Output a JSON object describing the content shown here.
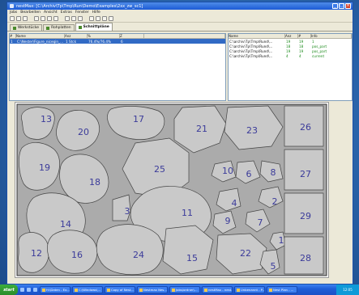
{
  "window": {
    "title": "nestMax: [C:\\Archiv\\Tp\\Tmp\\Run\\Demo\\Examples\\2xx_zw_sc1]"
  },
  "menu": [
    "Jobs",
    "Bearbeiten",
    "Ansicht",
    "Extras",
    "Fenster",
    "Hilfe"
  ],
  "tabs": [
    {
      "label": "Werkstücke"
    },
    {
      "label": "Rohplatten"
    },
    {
      "label": "Schnittpläne"
    }
  ],
  "left_table": {
    "headers": [
      "#",
      "Name",
      "Anz",
      "%",
      "Z",
      ""
    ],
    "rows": [
      [
        "1",
        "C:\\Nester\\Figure_niceqin_...",
        "1 Stck",
        "76.4%/76.4%",
        "6",
        ""
      ]
    ]
  },
  "right_table": {
    "headers": [
      "Name",
      "Anz",
      "#",
      "Info"
    ],
    "rows": [
      [
        "C:\\archiv\\Tp\\Tmp\\Rund\\...",
        "19",
        "19",
        "1"
      ],
      [
        "C:\\archiv\\Tp\\Tmp\\Rund\\...",
        "18",
        "18",
        "pos_part"
      ],
      [
        "C:\\archiv\\Tp\\Tmp\\Rund\\...",
        "19",
        "19",
        "pos_part"
      ],
      [
        "C:\\archiv\\Tp\\Tmp\\Rund\\...",
        "4",
        "4",
        "current"
      ]
    ]
  },
  "nest": {
    "parts": [
      {
        "label": "13",
        "color": "#c9c9c9"
      },
      {
        "label": "20",
        "color": "#c9c9c9"
      },
      {
        "label": "17",
        "color": "#c9c9c9"
      },
      {
        "label": "21",
        "color": "#c9c9c9"
      },
      {
        "label": "23",
        "color": "#c9c9c9"
      },
      {
        "label": "26",
        "color": "#c9c9c9"
      },
      {
        "label": "19",
        "color": "#c9c9c9"
      },
      {
        "label": "18",
        "color": "#c9c9c9"
      },
      {
        "label": "25",
        "color": "#c9c9c9"
      },
      {
        "label": "10",
        "color": "#c9c9c9"
      },
      {
        "label": "6",
        "color": "#c9c9c9"
      },
      {
        "label": "8",
        "color": "#c9c9c9"
      },
      {
        "label": "27",
        "color": "#c9c9c9"
      },
      {
        "label": "3",
        "color": "#c9c9c9"
      },
      {
        "label": "11",
        "color": "#c9c9c9"
      },
      {
        "label": "4",
        "color": "#c9c9c9"
      },
      {
        "label": "2",
        "color": "#c9c9c9"
      },
      {
        "label": "14",
        "color": "#c9c9c9"
      },
      {
        "label": "9",
        "color": "#c9c9c9"
      },
      {
        "label": "7",
        "color": "#c9c9c9"
      },
      {
        "label": "29",
        "color": "#c9c9c9"
      },
      {
        "label": "1",
        "color": "#c9c9c9"
      },
      {
        "label": "12",
        "color": "#c9c9c9"
      },
      {
        "label": "16",
        "color": "#c9c9c9"
      },
      {
        "label": "24",
        "color": "#c9c9c9"
      },
      {
        "label": "15",
        "color": "#c9c9c9"
      },
      {
        "label": "22",
        "color": "#c9c9c9"
      },
      {
        "label": "28",
        "color": "#c9c9c9"
      },
      {
        "label": "5",
        "color": "#c9c9c9"
      }
    ],
    "label_color": "#3b3b9a",
    "sheet_color": "#ababab"
  },
  "taskbar": {
    "start": "start",
    "buttons": [
      "H:\\Daten - Ex...",
      "C:\\Windows\\...",
      "Copy of Nest...",
      "Nestmax Nes...",
      "Jobs/ordner\\...",
      "nestMax - nest...",
      "Unbenannt - P...",
      "Nest Plan - ..."
    ],
    "clock": "12:05"
  }
}
